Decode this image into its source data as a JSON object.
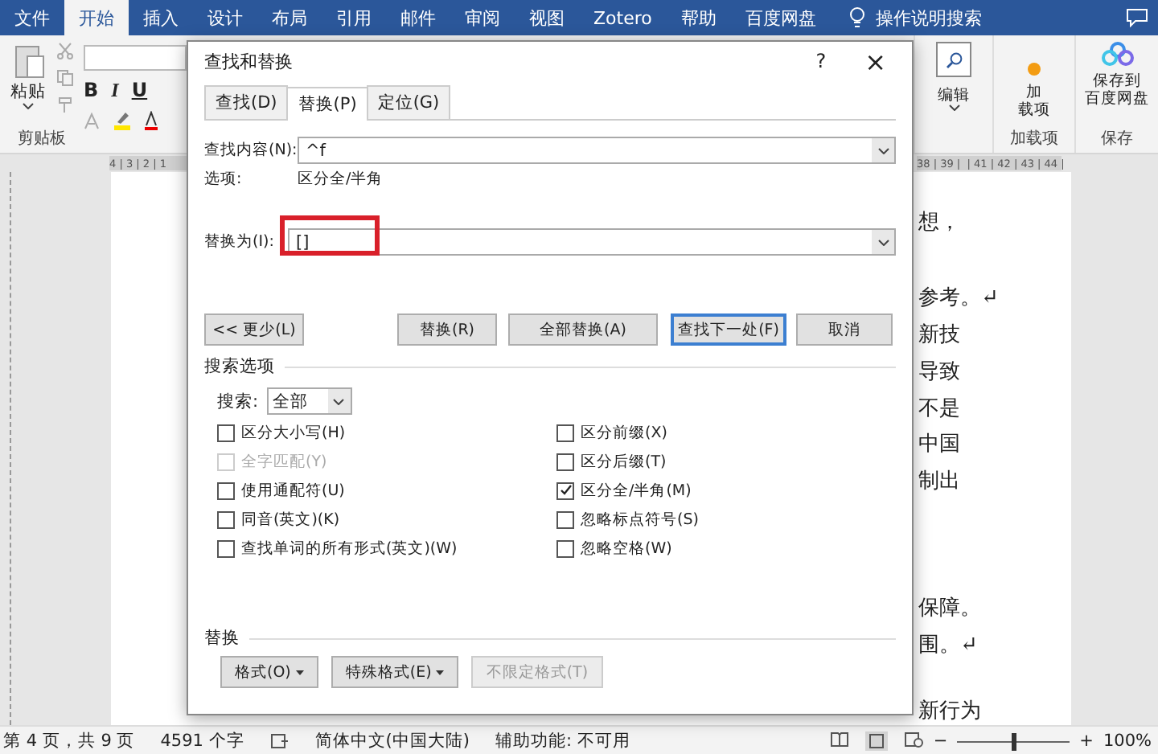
{
  "ribbon_tabs": [
    {
      "label": "文件",
      "selected": false
    },
    {
      "label": "开始",
      "selected": true
    },
    {
      "label": "插入",
      "selected": false
    },
    {
      "label": "设计",
      "selected": false
    },
    {
      "label": "布局",
      "selected": false
    },
    {
      "label": "引用",
      "selected": false
    },
    {
      "label": "邮件",
      "selected": false
    },
    {
      "label": "审阅",
      "selected": false
    },
    {
      "label": "视图",
      "selected": false
    },
    {
      "label": "Zotero",
      "selected": false
    },
    {
      "label": "帮助",
      "selected": false
    },
    {
      "label": "百度网盘",
      "selected": false
    }
  ],
  "tell_me": "操作说明搜索",
  "ribbon_left": {
    "paste_label": "粘贴",
    "font_buttons": [
      "B",
      "I",
      "U"
    ],
    "group_label": "剪贴板"
  },
  "editing": {
    "label": "编辑"
  },
  "addins": {
    "label_lines": [
      "加",
      "载项"
    ],
    "group_label": "加载项"
  },
  "save": {
    "label_lines": [
      "保存到",
      "百度网盘"
    ],
    "group_label": "保存"
  },
  "ruler": {
    "left": "4 | 3 | 2 | 1",
    "right": "38 | 39 |  | 41 | 42 | 43 | 44 |"
  },
  "document_lines": [
    "想，",
    "参考。↵",
    "新技",
    "导致",
    "不是",
    "中国",
    "制出",
    "保障。",
    "围。↵",
    "新行为"
  ],
  "dialog": {
    "title": "查找和替换",
    "help": "?",
    "close": "×",
    "tabs": [
      {
        "label": "查找(D)",
        "selected": false
      },
      {
        "label": "替换(P)",
        "selected": true
      },
      {
        "label": "定位(G)",
        "selected": false
      }
    ],
    "find": {
      "label": "查找内容(N):",
      "value": "^f"
    },
    "options_label": "选项:",
    "options_value": "区分全/半角",
    "replace": {
      "label": "替换为(I):",
      "value": "[]",
      "highlighted": true
    },
    "buttons": [
      {
        "label": "<< 更少(L)",
        "default": false
      },
      {
        "label": "替换(R)",
        "default": false
      },
      {
        "label": "全部替换(A)",
        "default": false
      },
      {
        "label": "查找下一处(F)",
        "default": true
      },
      {
        "label": "取消",
        "default": false
      }
    ],
    "search_options_title": "搜索选项",
    "search": {
      "label": "搜索:",
      "value": "全部"
    },
    "checkboxes_left": [
      {
        "label": "区分大小写(H)",
        "checked": false,
        "disabled": false
      },
      {
        "label": "全字匹配(Y)",
        "checked": false,
        "disabled": true
      },
      {
        "label": "使用通配符(U)",
        "checked": false,
        "disabled": false
      },
      {
        "label": "同音(英文)(K)",
        "checked": false,
        "disabled": false
      },
      {
        "label": "查找单词的所有形式(英文)(W)",
        "checked": false,
        "disabled": false
      }
    ],
    "checkboxes_right": [
      {
        "label": "区分前缀(X)",
        "checked": false,
        "disabled": false
      },
      {
        "label": "区分后缀(T)",
        "checked": false,
        "disabled": false
      },
      {
        "label": "区分全/半角(M)",
        "checked": true,
        "disabled": false
      },
      {
        "label": "忽略标点符号(S)",
        "checked": false,
        "disabled": false
      },
      {
        "label": "忽略空格(W)",
        "checked": false,
        "disabled": false
      }
    ],
    "replace_section_title": "替换",
    "format_buttons": [
      {
        "label": "格式(O)",
        "has_menu": true,
        "disabled": false
      },
      {
        "label": "特殊格式(E)",
        "has_menu": true,
        "disabled": false
      },
      {
        "label": "不限定格式(T)",
        "has_menu": false,
        "disabled": true
      }
    ]
  },
  "status_bar": {
    "page": "第 4 页，共 9 页",
    "words": "4591 个字",
    "language": "简体中文(中国大陆)",
    "accessibility": "辅助功能: 不可用",
    "zoom_out": "−",
    "zoom_in": "+",
    "zoom_slider": {
      "level": 0.5
    },
    "zoom": "100%"
  }
}
